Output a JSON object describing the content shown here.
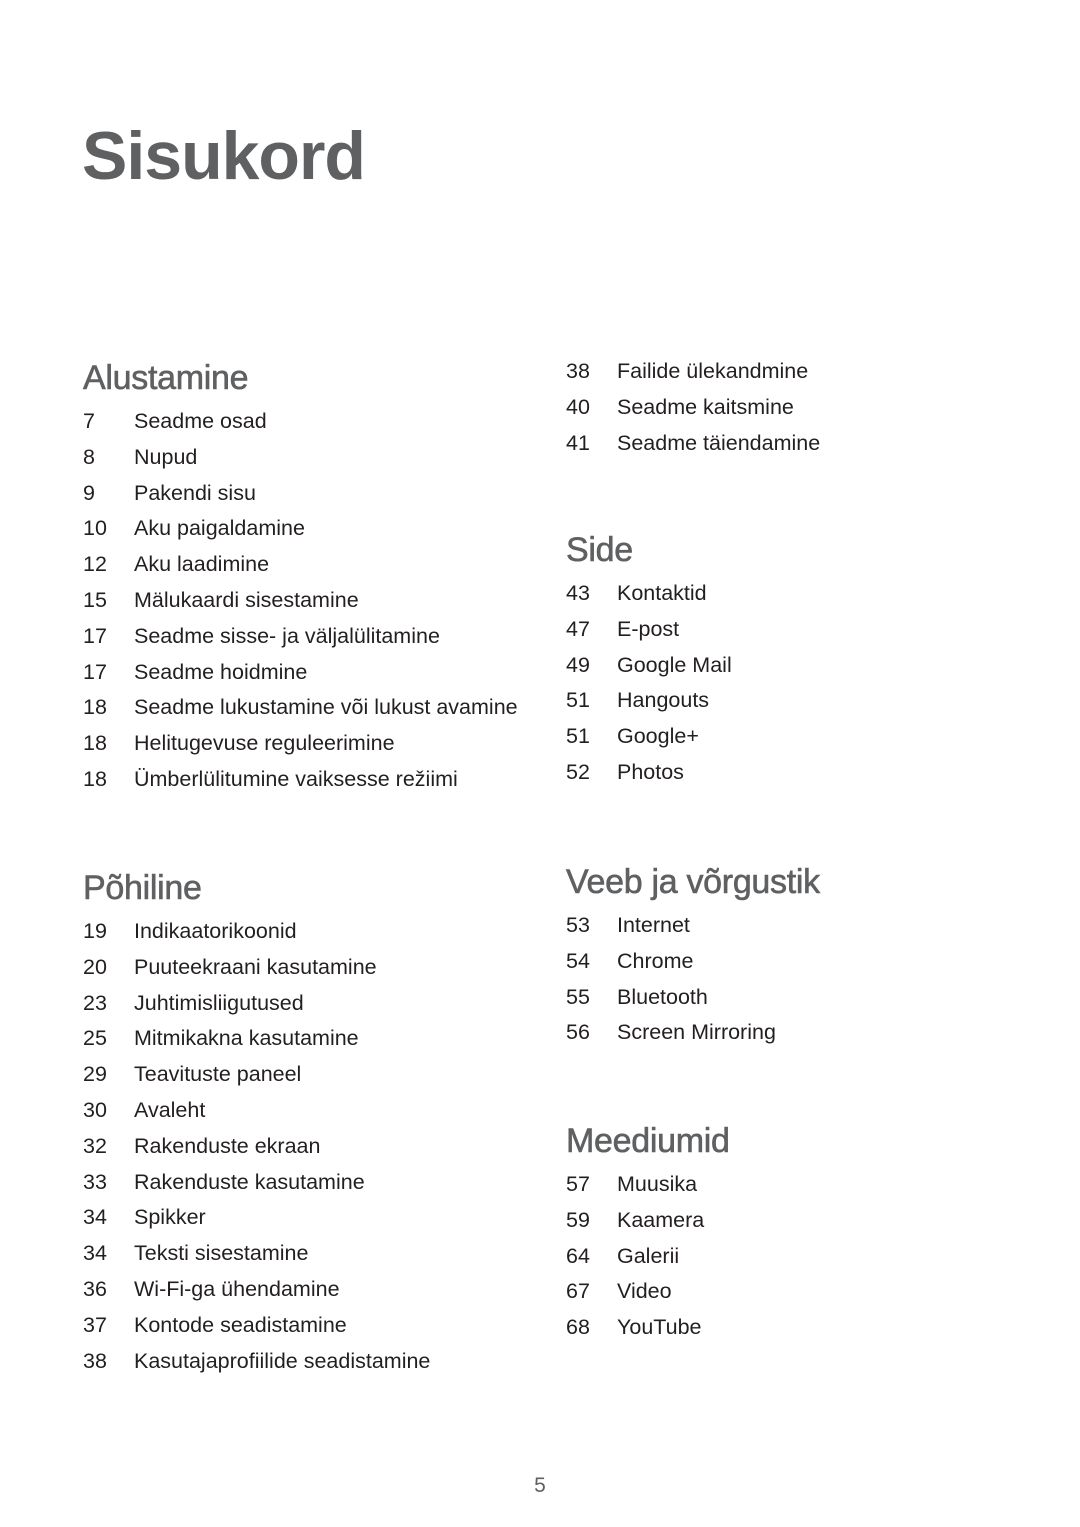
{
  "page": {
    "title": "Sisukord",
    "page_number": "5"
  },
  "sections": {
    "alustamine": {
      "heading": "Alustamine",
      "items": [
        {
          "page": "7",
          "label": "Seadme osad"
        },
        {
          "page": "8",
          "label": "Nupud"
        },
        {
          "page": "9",
          "label": "Pakendi sisu"
        },
        {
          "page": "10",
          "label": "Aku paigaldamine"
        },
        {
          "page": "12",
          "label": "Aku laadimine"
        },
        {
          "page": "15",
          "label": "Mälukaardi sisestamine"
        },
        {
          "page": "17",
          "label": "Seadme sisse- ja väljalülitamine"
        },
        {
          "page": "17",
          "label": "Seadme hoidmine"
        },
        {
          "page": "18",
          "label": "Seadme lukustamine või lukust avamine"
        },
        {
          "page": "18",
          "label": "Helitugevuse reguleerimine"
        },
        {
          "page": "18",
          "label": "Ümberlülitumine vaiksesse režiimi"
        }
      ]
    },
    "pohiline": {
      "heading": "Põhiline",
      "items": [
        {
          "page": "19",
          "label": "Indikaatorikoonid"
        },
        {
          "page": "20",
          "label": "Puuteekraani kasutamine"
        },
        {
          "page": "23",
          "label": "Juhtimisliigutused"
        },
        {
          "page": "25",
          "label": "Mitmikakna kasutamine"
        },
        {
          "page": "29",
          "label": "Teavituste paneel"
        },
        {
          "page": "30",
          "label": "Avaleht"
        },
        {
          "page": "32",
          "label": "Rakenduste ekraan"
        },
        {
          "page": "33",
          "label": "Rakenduste kasutamine"
        },
        {
          "page": "34",
          "label": "Spikker"
        },
        {
          "page": "34",
          "label": "Teksti sisestamine"
        },
        {
          "page": "36",
          "label": "Wi-Fi-ga ühendamine"
        },
        {
          "page": "37",
          "label": "Kontode seadistamine"
        },
        {
          "page": "38",
          "label": "Kasutajaprofiilide seadistamine"
        }
      ]
    },
    "pohiline_continued": {
      "items": [
        {
          "page": "38",
          "label": "Failide ülekandmine"
        },
        {
          "page": "40",
          "label": "Seadme kaitsmine"
        },
        {
          "page": "41",
          "label": "Seadme täiendamine"
        }
      ]
    },
    "side": {
      "heading": "Side",
      "items": [
        {
          "page": "43",
          "label": "Kontaktid"
        },
        {
          "page": "47",
          "label": "E-post"
        },
        {
          "page": "49",
          "label": "Google Mail"
        },
        {
          "page": "51",
          "label": "Hangouts"
        },
        {
          "page": "51",
          "label": "Google+"
        },
        {
          "page": "52",
          "label": "Photos"
        }
      ]
    },
    "veeb": {
      "heading": "Veeb ja võrgustik",
      "items": [
        {
          "page": "53",
          "label": "Internet"
        },
        {
          "page": "54",
          "label": "Chrome"
        },
        {
          "page": "55",
          "label": "Bluetooth"
        },
        {
          "page": "56",
          "label": "Screen Mirroring"
        }
      ]
    },
    "meediumid": {
      "heading": "Meediumid",
      "items": [
        {
          "page": "57",
          "label": "Muusika"
        },
        {
          "page": "59",
          "label": "Kaamera"
        },
        {
          "page": "64",
          "label": "Galerii"
        },
        {
          "page": "67",
          "label": "Video"
        },
        {
          "page": "68",
          "label": "YouTube"
        }
      ]
    }
  }
}
